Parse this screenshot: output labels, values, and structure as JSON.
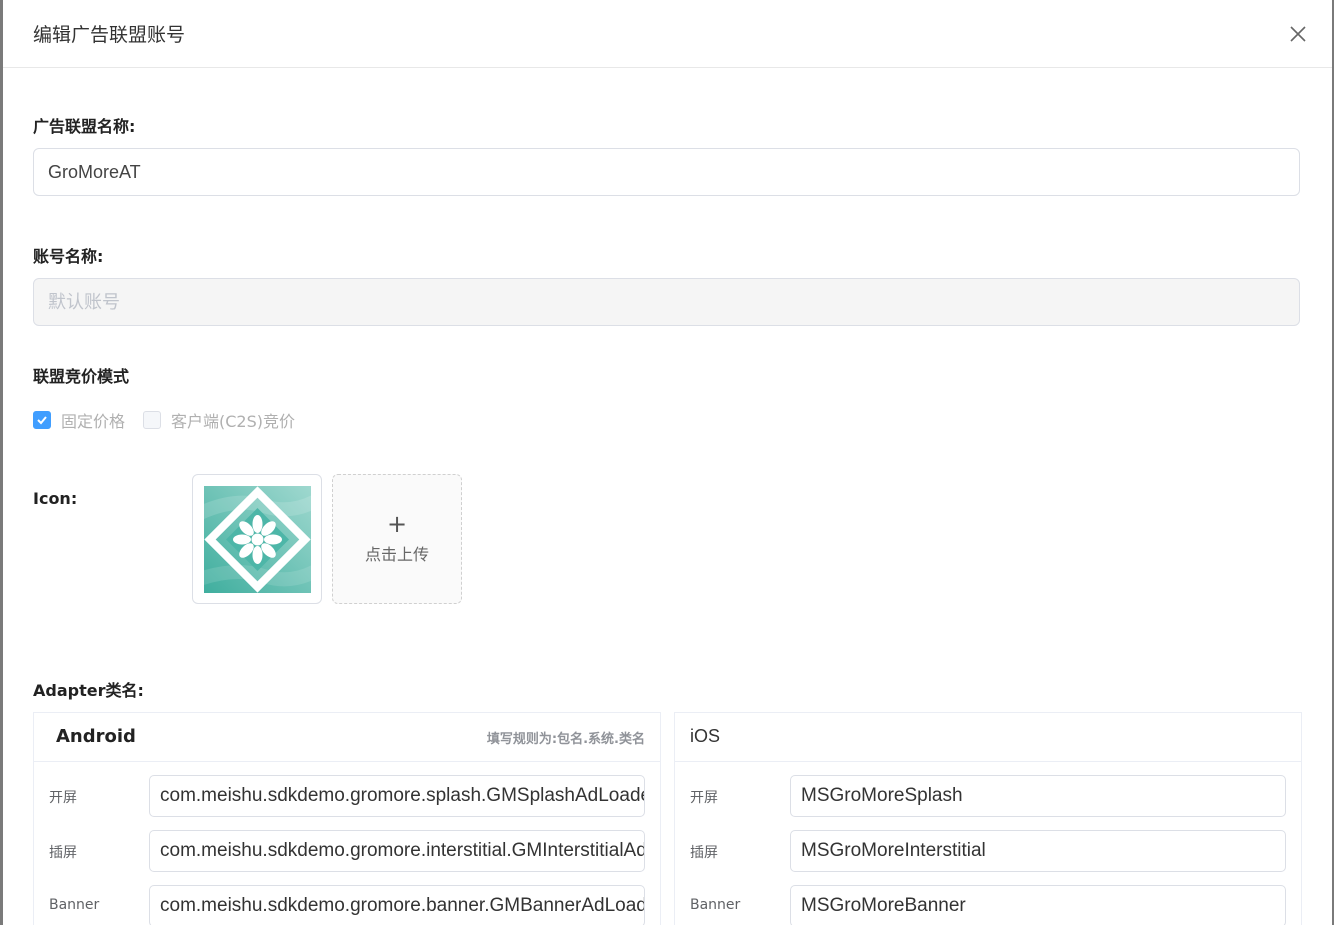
{
  "dialog": {
    "title": "编辑广告联盟账号"
  },
  "form": {
    "alliance_name_label": "广告联盟名称:",
    "alliance_name_value": "GroMoreAT",
    "account_name_label": "账号名称:",
    "account_name_placeholder": "默认账号",
    "bidding_mode_label": "联盟竞价模式",
    "bidding_options": [
      {
        "label": "固定价格",
        "checked": true
      },
      {
        "label": "客户端(C2S)竞价",
        "checked": false
      }
    ],
    "icon_label": "Icon:",
    "upload_plus": "+",
    "upload_text": "点击上传",
    "adapter_label": "Adapter类名:"
  },
  "android": {
    "title": "Android",
    "hint": "填写规则为:包名.系统.类名",
    "rows": [
      {
        "label": "开屏",
        "value": "com.meishu.sdkdemo.gromore.splash.GMSplashAdLoader"
      },
      {
        "label": "插屏",
        "value": "com.meishu.sdkdemo.gromore.interstitial.GMInterstitialAdLoader"
      },
      {
        "label": "Banner",
        "value": "com.meishu.sdkdemo.gromore.banner.GMBannerAdLoader"
      }
    ]
  },
  "ios": {
    "title": "iOS",
    "rows": [
      {
        "label": "开屏",
        "value": "MSGroMoreSplash"
      },
      {
        "label": "插屏",
        "value": "MSGroMoreInterstitial"
      },
      {
        "label": "Banner",
        "value": "MSGroMoreBanner"
      }
    ]
  },
  "colors": {
    "checkbox_checked": "#409eff",
    "icon_teal": "#4db6a8"
  },
  "icons": {
    "close": "close-icon",
    "check": "check-icon",
    "app_icon": "gromore-logo-icon"
  }
}
